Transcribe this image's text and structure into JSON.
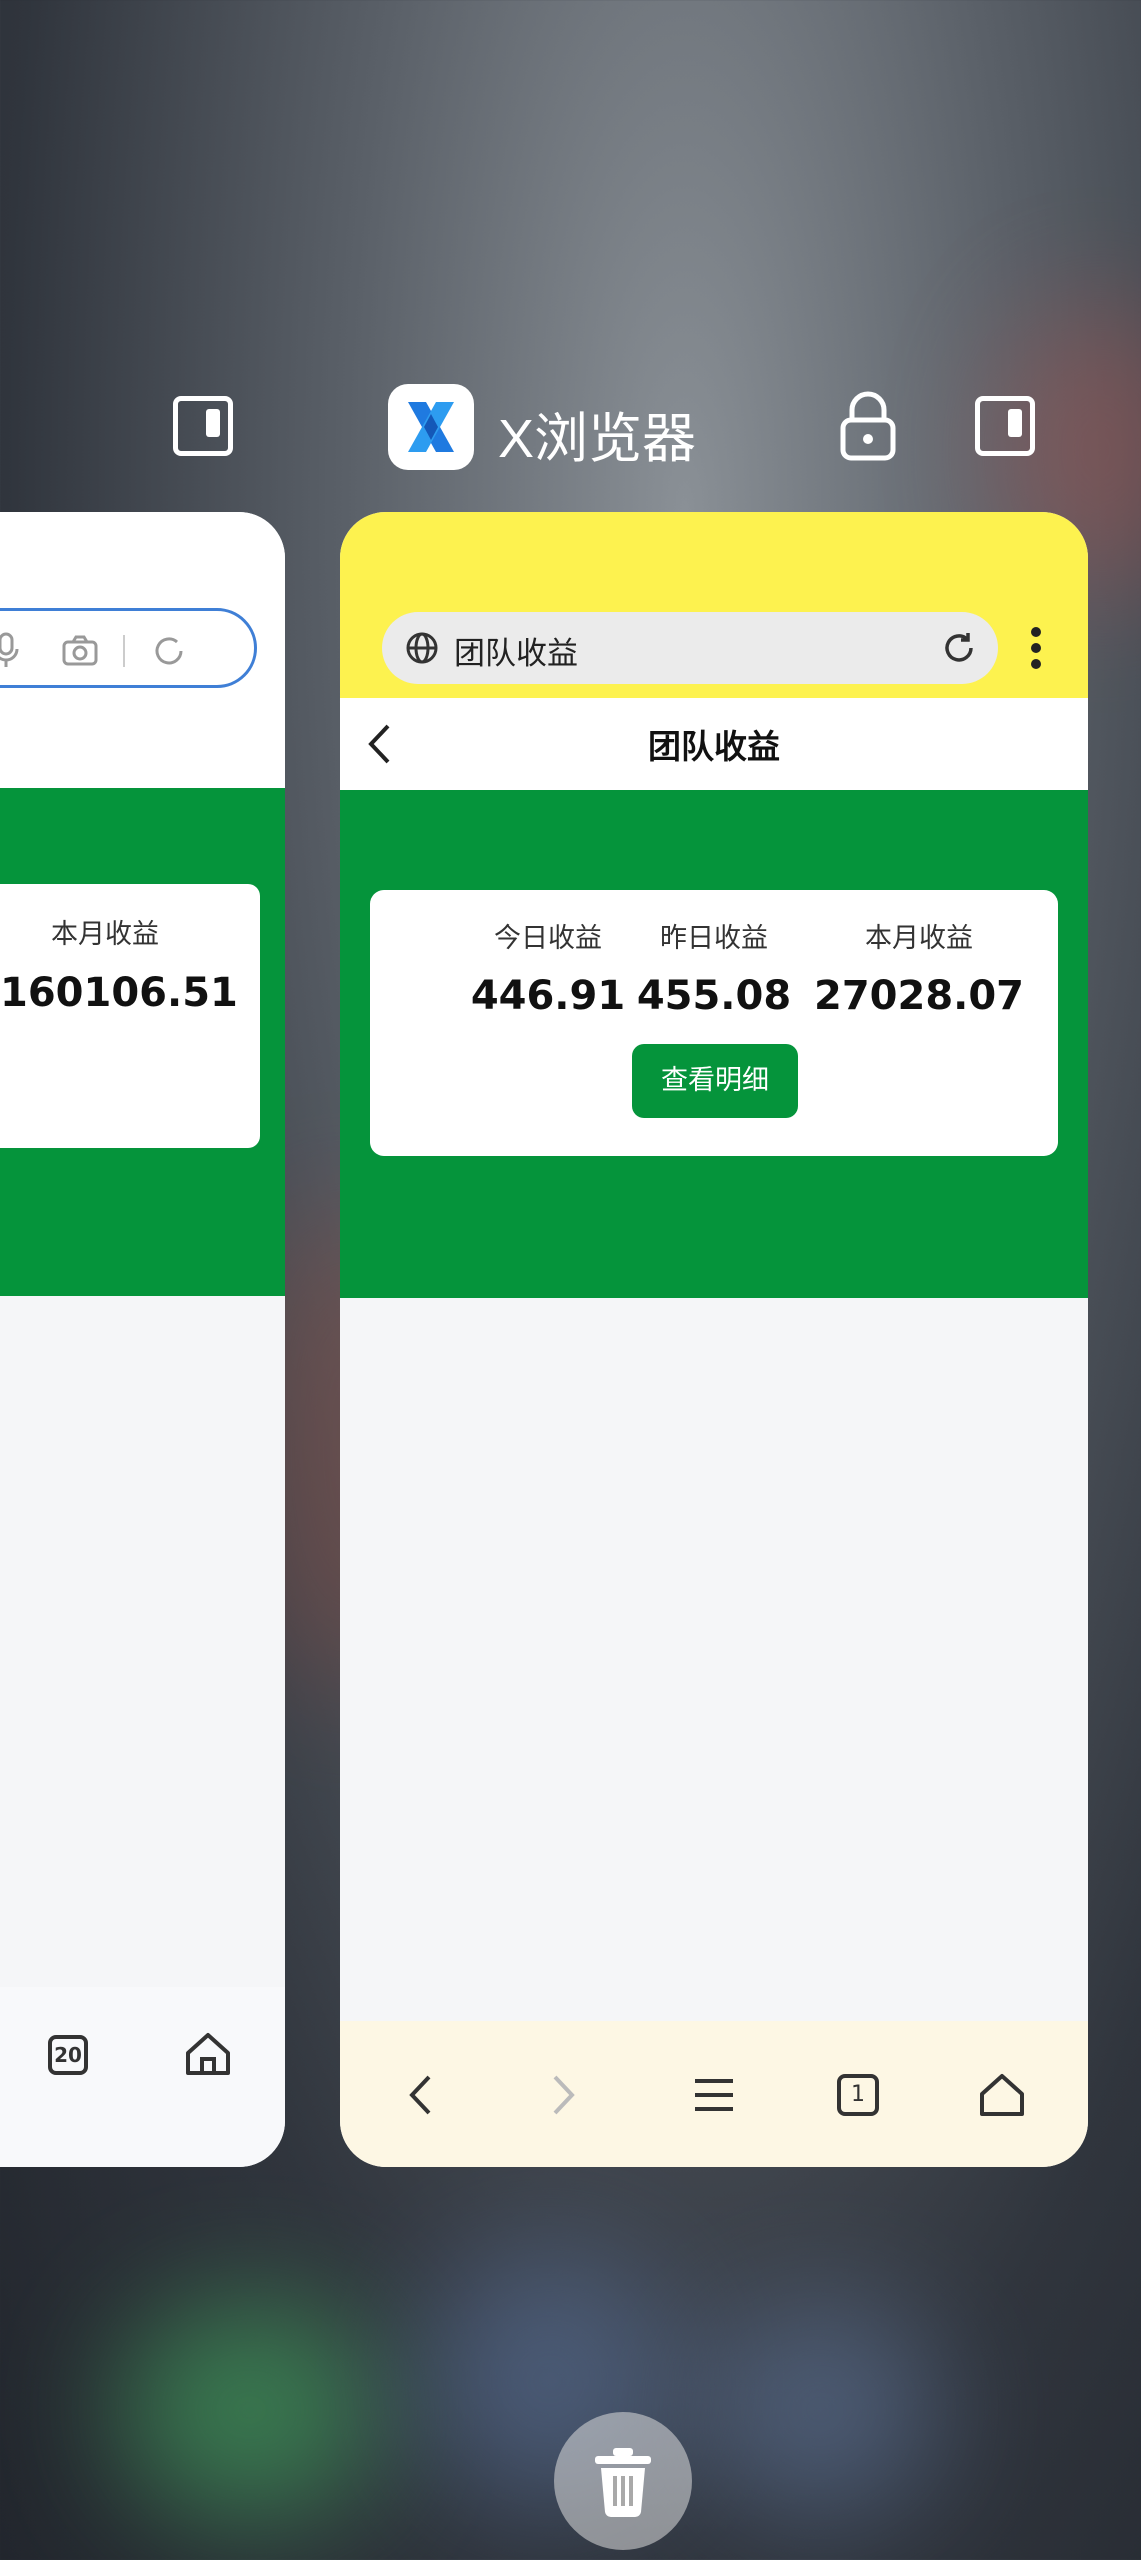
{
  "recents": {
    "app_name": "X浏览器",
    "accent_yellow": "#fdf24f",
    "accent_green": "#05943b"
  },
  "left_card": {
    "month_label": "本月收益",
    "month_value": "160106.51",
    "tab_count": "20"
  },
  "right_card": {
    "url_text": "团队收益",
    "page_title": "团队收益",
    "stats": [
      {
        "label": "今日收益",
        "value": "446.91"
      },
      {
        "label": "昨日收益",
        "value": "455.08"
      },
      {
        "label": "本月收益",
        "value": "27028.07"
      }
    ],
    "detail_button": "查看明细",
    "tab_count": "1"
  }
}
